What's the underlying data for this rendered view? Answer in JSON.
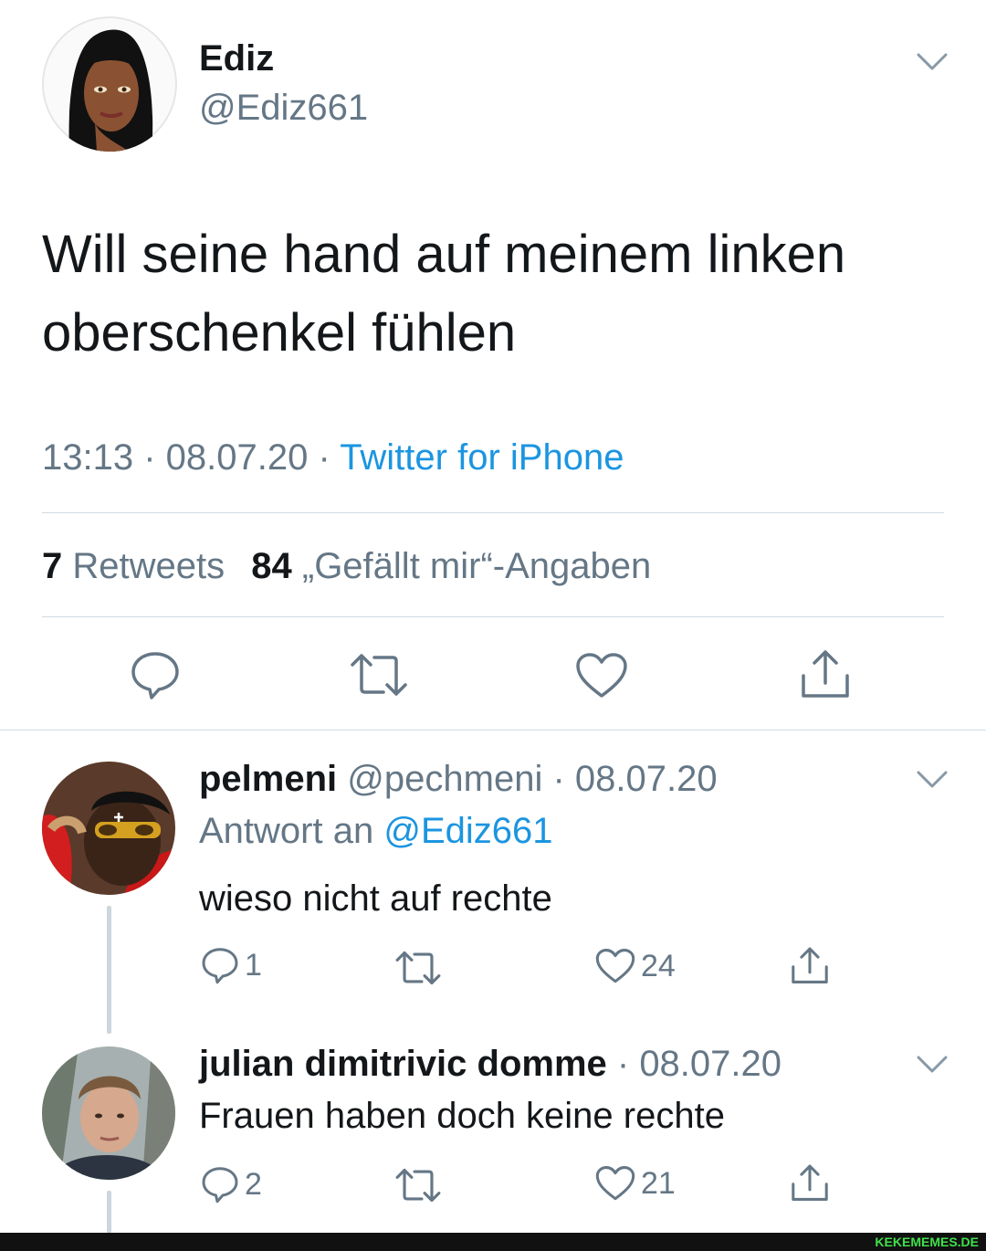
{
  "tweet": {
    "name": "Ediz",
    "handle": "@Ediz661",
    "text_line1": "Will seine hand auf meinem linken",
    "text_line2": "oberschenkel fühlen",
    "time": "13:13",
    "date": "08.07.20",
    "source": "Twitter for iPhone",
    "retweets_count": "7",
    "retweets_label": "Retweets",
    "likes_count": "84",
    "likes_label": "„Gefällt mir“-Angaben",
    "separator": " · "
  },
  "replies": [
    {
      "name": "pelmeni",
      "handle": "@pechmeni",
      "date": "08.07.20",
      "reply_prefix": "Antwort an",
      "reply_to": "@Ediz661",
      "text": "wieso nicht auf rechte",
      "reply_count": "1",
      "like_count": "24"
    },
    {
      "name": "julian dimitrivic domme",
      "date": "08.07.20",
      "text": "Frauen haben doch keine rechte",
      "reply_count": "2",
      "like_count": "21"
    }
  ],
  "watermark": "KEKEMEMES.DE",
  "icons": [
    "chevron-down-icon",
    "reply-icon",
    "retweet-icon",
    "like-icon",
    "share-icon"
  ],
  "colors": {
    "accent": "#1b95e0",
    "muted": "#657786",
    "text": "#14171a",
    "divider": "#d0dbe3"
  }
}
